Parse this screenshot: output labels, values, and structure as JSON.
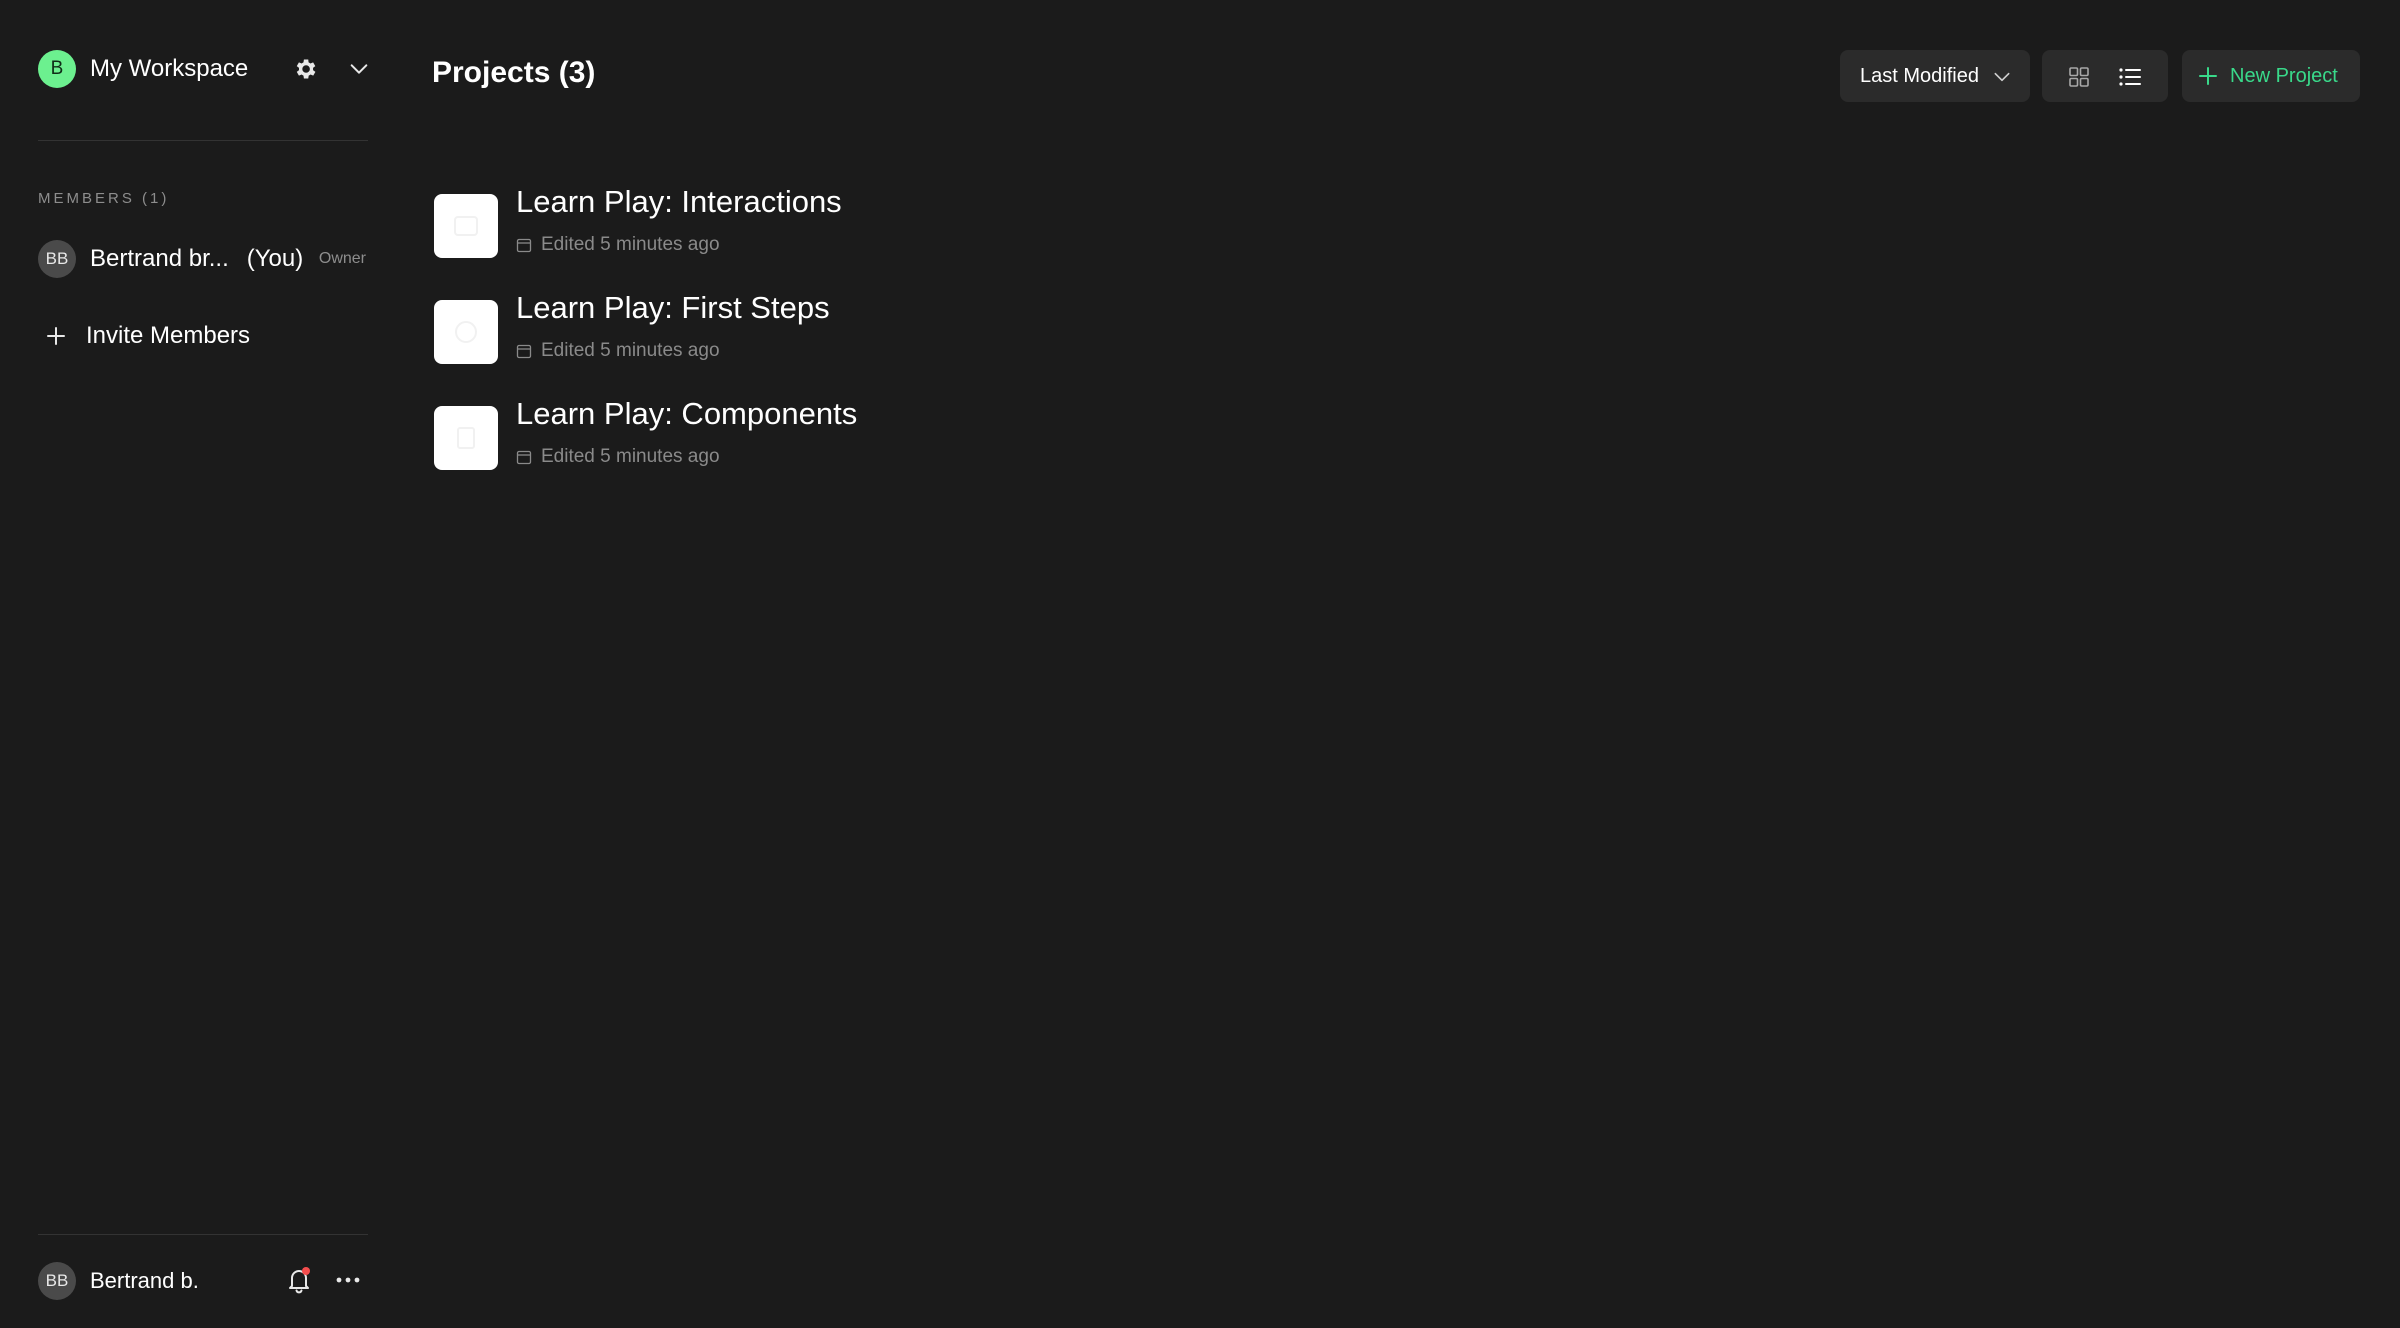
{
  "workspace": {
    "avatar_letter": "B",
    "name": "My Workspace",
    "avatar_color": "#6cf08f"
  },
  "members": {
    "heading": "MEMBERS (1)",
    "list": [
      {
        "initials": "BB",
        "name": "Bertrand br...",
        "you": "(You)",
        "role": "Owner"
      }
    ],
    "invite_label": "Invite Members"
  },
  "footer": {
    "initials": "BB",
    "name": "Bertrand b."
  },
  "main": {
    "title": "Projects (3)",
    "sort_label": "Last Modified",
    "new_project_label": "New Project",
    "accent_color": "#39d98a"
  },
  "projects": [
    {
      "title": "Learn Play: Interactions",
      "edited": "Edited 5 minutes ago"
    },
    {
      "title": "Learn Play: First Steps",
      "edited": "Edited 5 minutes ago"
    },
    {
      "title": "Learn Play: Components",
      "edited": "Edited 5 minutes ago"
    }
  ],
  "icons": [
    "gear-icon",
    "chevron-down-icon",
    "plus-icon",
    "bell-icon",
    "more-icon",
    "grid-view-icon",
    "list-view-icon",
    "calendar-icon"
  ]
}
